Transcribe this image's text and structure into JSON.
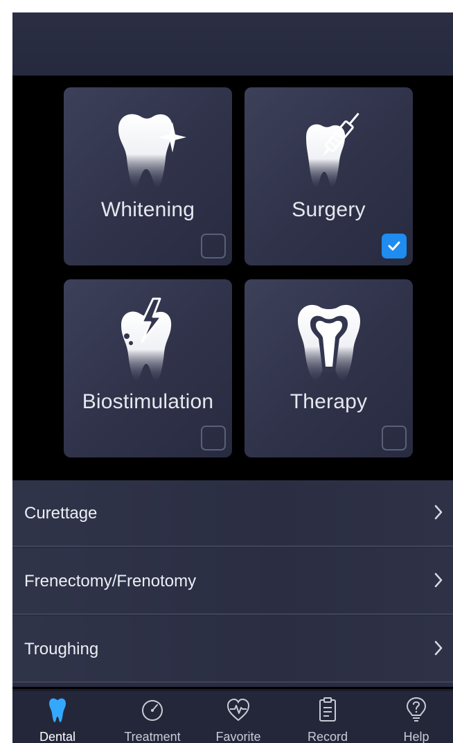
{
  "tiles": [
    {
      "label": "Whitening",
      "checked": false,
      "icon": "tooth-sparkle-icon"
    },
    {
      "label": "Surgery",
      "checked": true,
      "icon": "tooth-scalpel-icon"
    },
    {
      "label": "Biostimulation",
      "checked": false,
      "icon": "tooth-lightning-icon"
    },
    {
      "label": "Therapy",
      "checked": false,
      "icon": "tooth-root-icon"
    }
  ],
  "menu": {
    "items": [
      {
        "label": "Curettage"
      },
      {
        "label": "Frenectomy/Frenotomy"
      },
      {
        "label": "Troughing"
      }
    ]
  },
  "tabbar": {
    "tabs": [
      {
        "label": "Dental",
        "icon": "tooth-icon",
        "active": true
      },
      {
        "label": "Treatment",
        "icon": "gauge-icon",
        "active": false
      },
      {
        "label": "Favorite",
        "icon": "heart-pulse-icon",
        "active": false
      },
      {
        "label": "Record",
        "icon": "clipboard-icon",
        "active": false
      },
      {
        "label": "Help",
        "icon": "lightbulb-question-icon",
        "active": false
      }
    ]
  },
  "colors": {
    "accent": "#1f8cf0",
    "tile": "#33364f",
    "header": "#2b2e44"
  }
}
